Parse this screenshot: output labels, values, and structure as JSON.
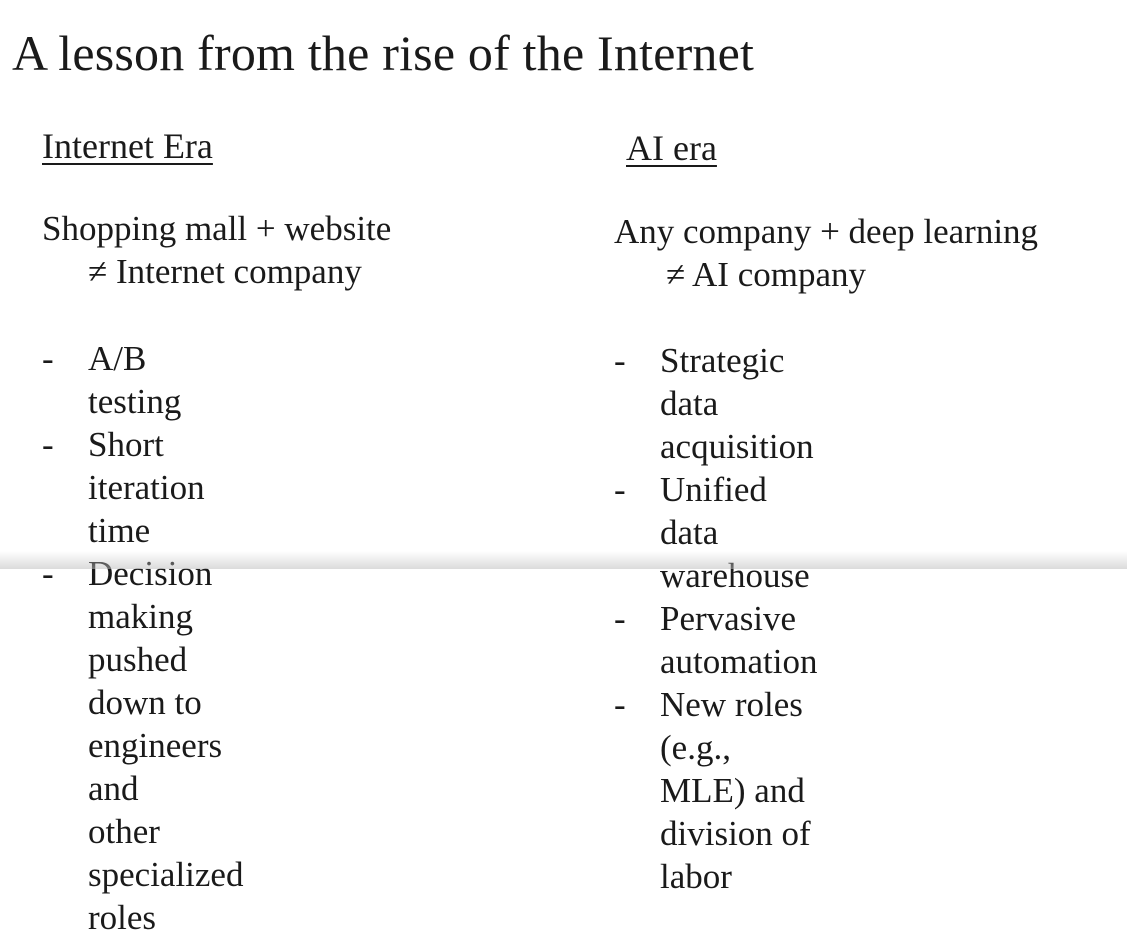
{
  "title": "A lesson from the rise of the Internet",
  "left": {
    "heading": "Internet Era",
    "equation_line1": "Shopping mall + website",
    "equation_line2": "≠ Internet company",
    "bullet_marker": "-",
    "bullets": [
      "A/B testing",
      "Short iteration time",
      "Decision making pushed\ndown to engineers and\nother specialized roles"
    ]
  },
  "right": {
    "heading": " AI era",
    "equation_line1": "Any company + deep learning",
    "equation_line2": "≠ AI company",
    "bullet_marker": "-",
    "bullets": [
      "Strategic data acquisition",
      "Unified data warehouse",
      "Pervasive automation",
      "New roles (e.g., MLE) and\ndivision of labor"
    ]
  }
}
